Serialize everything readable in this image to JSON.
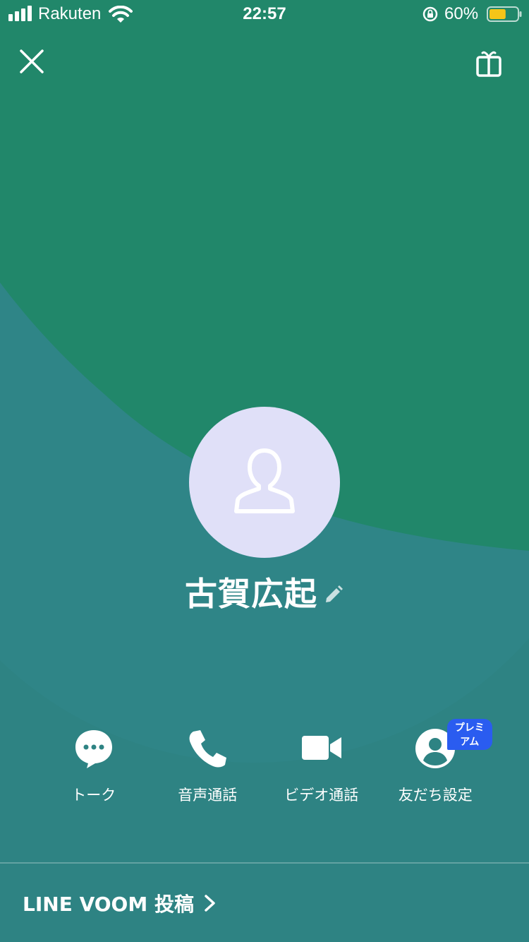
{
  "status_bar": {
    "carrier": "Rakuten",
    "time": "22:57",
    "battery_percent": "60%",
    "battery_level": 0.6,
    "battery_color": "#f5c518"
  },
  "colors": {
    "top_green": "#21876a",
    "bottom_teal": "#2e8383",
    "avatar_bg": "#e0e0f8",
    "premium_blue": "#2a5cf0"
  },
  "header": {
    "close_icon": "close-icon",
    "gift_icon": "gift-icon"
  },
  "profile": {
    "name": "古賀広起",
    "avatar_icon": "person-outline-icon",
    "edit_icon": "pencil-icon"
  },
  "actions": [
    {
      "label": "トーク",
      "icon": "chat-bubble-icon"
    },
    {
      "label": "音声通話",
      "icon": "phone-icon"
    },
    {
      "label": "ビデオ通話",
      "icon": "video-camera-icon"
    },
    {
      "label": "友だち設定",
      "icon": "friend-settings-icon",
      "badge": "プレミアム"
    }
  ],
  "voom": {
    "label": "LINE VOOM 投稿"
  }
}
